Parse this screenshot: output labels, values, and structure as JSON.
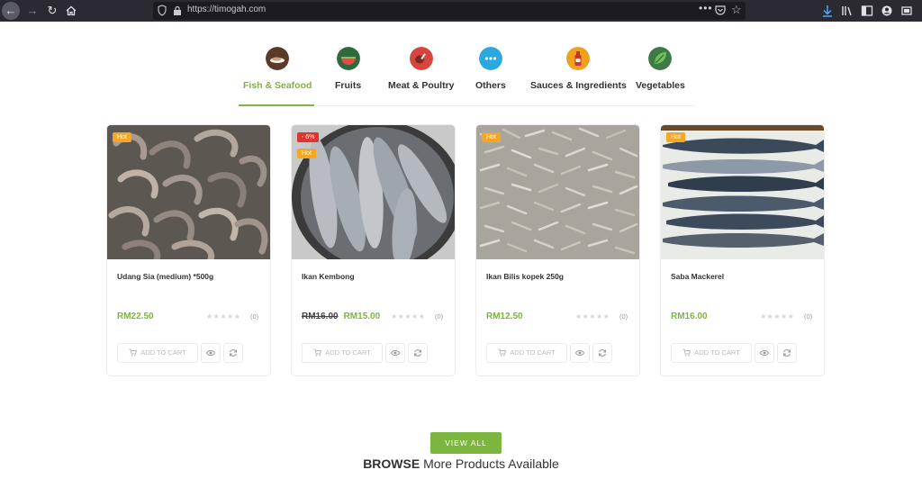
{
  "browser": {
    "url": "https://timogah.com"
  },
  "categories": [
    {
      "label": "Fish & Seafood",
      "icon": "fish-icon",
      "color": "#5a3a28",
      "active": true
    },
    {
      "label": "Fruits",
      "icon": "watermelon-icon",
      "color": "#2f6b3a",
      "active": false
    },
    {
      "label": "Meat & Poultry",
      "icon": "meat-icon",
      "color": "#d6463c",
      "active": false
    },
    {
      "label": "Others",
      "icon": "more-icon",
      "color": "#2aa9e0",
      "active": false
    },
    {
      "label": "Sauces & Ingredients",
      "icon": "sauce-bottle-icon",
      "color": "#f0a020",
      "active": false
    },
    {
      "label": "Vegetables",
      "icon": "leaf-icon",
      "color": "#3d7a45",
      "active": false
    }
  ],
  "products": [
    {
      "name": "Udang Sia (medium) *500g",
      "badges": [
        "Hot"
      ],
      "old_price": "",
      "price": "RM22.50",
      "rating": 0,
      "rating_count": "(0)",
      "cart_label": "ADD TO CART",
      "image": "shrimp-photo"
    },
    {
      "name": "Ikan Kembong",
      "badges": [
        "- 6%",
        "Hot"
      ],
      "old_price": "RM16.00",
      "price": "RM15.00",
      "rating": 0,
      "rating_count": "(0)",
      "cart_label": "ADD TO CART",
      "image": "mackerel-bowl-photo"
    },
    {
      "name": "Ikan Bilis kopek 250g",
      "badges": [
        "Hot"
      ],
      "old_price": "",
      "price": "RM12.50",
      "rating": 0,
      "rating_count": "(0)",
      "cart_label": "ADD TO CART",
      "image": "anchovies-photo"
    },
    {
      "name": "Saba Mackerel",
      "badges": [
        "Hot"
      ],
      "old_price": "",
      "price": "RM16.00",
      "rating": 0,
      "rating_count": "(0)",
      "cart_label": "ADD TO CART",
      "image": "saba-mackerel-photo"
    }
  ],
  "footer": {
    "view_all": "VIEW ALL",
    "browse_bold": "BROWSE",
    "browse_rest": " More Products Available"
  },
  "colors": {
    "accent": "#7db63e",
    "hot_badge": "#f5a623",
    "sale_badge": "#e0342f"
  }
}
